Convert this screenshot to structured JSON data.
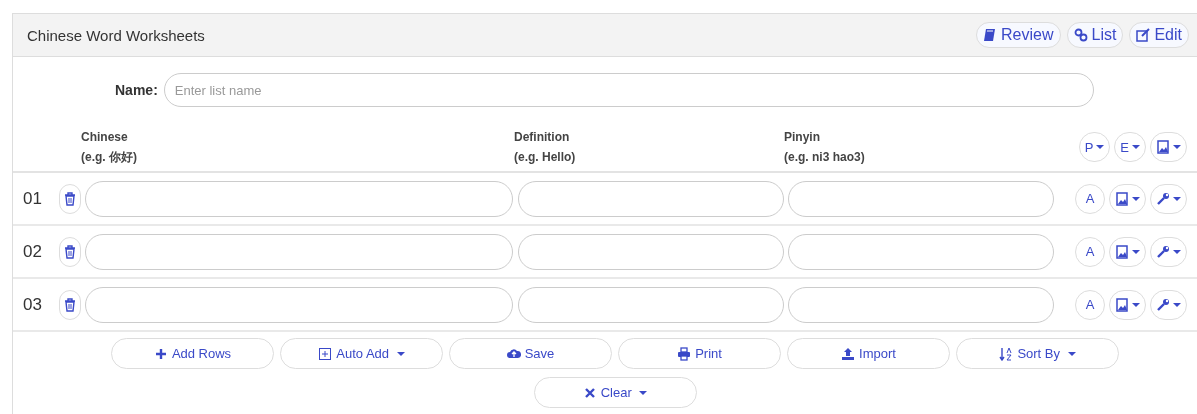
{
  "panel": {
    "title": "Chinese Word Worksheets"
  },
  "header_buttons": [
    {
      "label": "Review"
    },
    {
      "label": "List"
    },
    {
      "label": "Edit"
    }
  ],
  "name_field": {
    "label": "Name:",
    "placeholder": "Enter list name"
  },
  "columns": [
    {
      "title": "Chinese",
      "hint": "(e.g. 你好)"
    },
    {
      "title": "Definition",
      "hint": "(e.g. Hello)"
    },
    {
      "title": "Pinyin",
      "hint": "(e.g. ni3 hao3)"
    }
  ],
  "column_buttons": [
    {
      "kind": "text",
      "label": "P"
    },
    {
      "kind": "text",
      "label": "E"
    },
    {
      "kind": "image"
    }
  ],
  "rows": [
    {
      "number": "01",
      "audio_button": "A"
    },
    {
      "number": "02",
      "audio_button": "A"
    },
    {
      "number": "03",
      "audio_button": "A"
    }
  ],
  "actions": [
    {
      "label": "Add Rows",
      "dropdown": false
    },
    {
      "label": "Auto Add",
      "dropdown": true
    },
    {
      "label": "Save",
      "dropdown": false
    },
    {
      "label": "Print",
      "dropdown": false
    },
    {
      "label": "Import",
      "dropdown": false
    },
    {
      "label": "Sort By",
      "dropdown": true
    },
    {
      "label": "Clear",
      "dropdown": true
    }
  ]
}
